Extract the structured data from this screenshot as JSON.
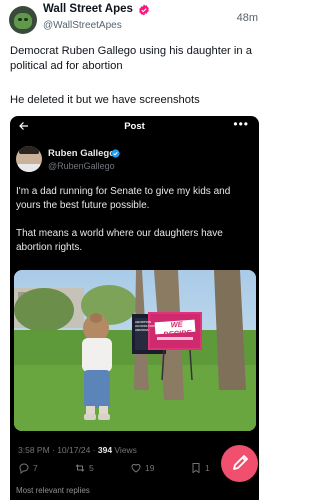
{
  "tweet": {
    "author_name": "Wall Street Apes",
    "author_handle": "@WallStreetApes",
    "time_ago": "48m",
    "text_line1": "Democrat Ruben Gallego using his daughter in a political ad for abortion",
    "text_line2": "He deleted it but we have screenshots"
  },
  "embed": {
    "header_title": "Post",
    "author_name": "Ruben Gallego",
    "author_handle": "@RubenGallego",
    "paragraph1": "I'm a dad running for Senate to give my kids and yours the best future possible.",
    "paragraph2": "That means a world where our daughters have abortion rights.",
    "sign_left": "ABORTION ACCESS FOR ARIZONA",
    "sign_right": "WE DECIDE",
    "time": "3:58 PM · 10/17/24 · ",
    "views_count": "394",
    "views_label": " Views",
    "replies": "7",
    "reposts": "5",
    "likes": "19",
    "bookmarks": "1",
    "related_label": "Most relevant replies"
  },
  "colors": {
    "verified": "#f91880",
    "fab": "#f0506e",
    "embed_bg": "#000000"
  },
  "icons": [
    "back-arrow-icon",
    "more-icon",
    "verified-icon",
    "reply-icon",
    "repost-icon",
    "like-icon",
    "bookmark-icon",
    "compose-icon"
  ]
}
